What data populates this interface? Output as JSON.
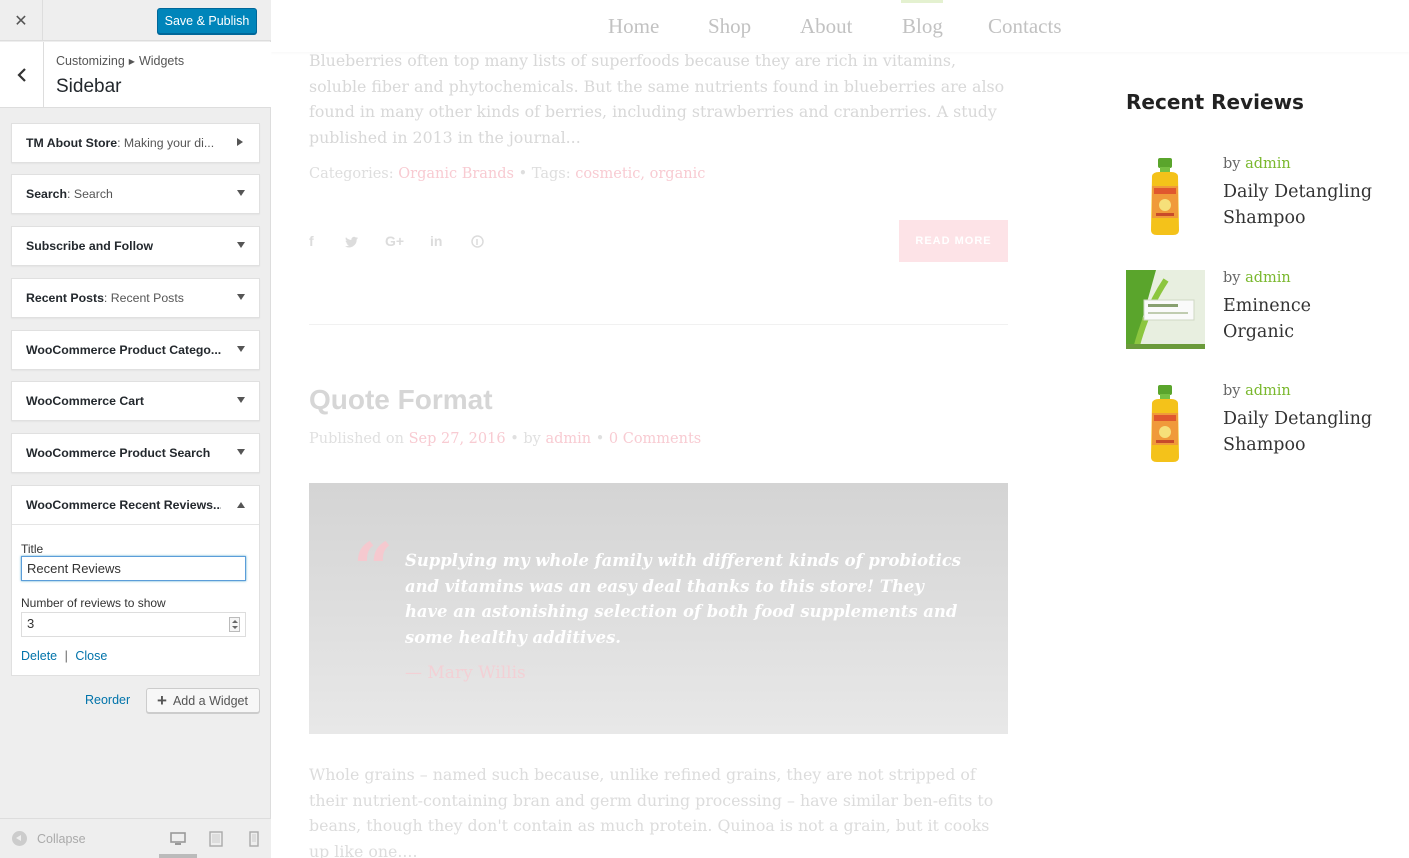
{
  "customizer": {
    "close_icon": "close-icon",
    "publish_label": "Save & Publish",
    "breadcrumb": {
      "root": "Customizing",
      "current": "Widgets"
    },
    "section_title": "Sidebar",
    "widgets": [
      {
        "name": "TM About Store",
        "sub": ": Making your di...",
        "state": "collapsed-right"
      },
      {
        "name": "Search",
        "sub": ": Search",
        "state": "collapsed"
      },
      {
        "name": "Subscribe and Follow",
        "sub": "",
        "state": "collapsed"
      },
      {
        "name": "Recent Posts",
        "sub": ": Recent Posts",
        "state": "collapsed"
      },
      {
        "name": "WooCommerce Product Catego...",
        "sub": "",
        "state": "collapsed"
      },
      {
        "name": "WooCommerce Cart",
        "sub": "",
        "state": "collapsed"
      },
      {
        "name": "WooCommerce Product Search",
        "sub": "",
        "state": "collapsed"
      }
    ],
    "open_widget": {
      "name": "WooCommerce Recent Reviews...",
      "title_label": "Title",
      "title_value": "Recent Reviews",
      "count_label": "Number of reviews to show",
      "count_value": "3",
      "delete_label": "Delete",
      "separator": "|",
      "close_label": "Close"
    },
    "reorder_label": "Reorder",
    "add_widget_label": "Add a Widget",
    "collapse_label": "Collapse"
  },
  "preview": {
    "nav": [
      "Home",
      "Shop",
      "About",
      "Blog",
      "Contacts"
    ],
    "active_nav": "Blog",
    "post1": {
      "excerpt": "Blueberries often top many lists of superfoods because they are rich in vitamins, soluble fiber and phytochemicals. But the same nutrients found in blueberries are also found in many other kinds of berries, including strawberries and cranberries. A study published in 2013 in the journal...",
      "categories_label": "Categories:",
      "category": "Organic Brands",
      "tags_label": "Tags:",
      "tag1": "cosmetic",
      "tag2": "organic",
      "read_more": "READ MORE"
    },
    "post2": {
      "title": "Quote Format",
      "published_label": "Published on",
      "date": "Sep 27, 2016",
      "by_label": "by",
      "author": "admin",
      "comments": "0 Comments",
      "quote": "Supplying my whole family with different kinds of probiotics and vitamins was an easy deal thanks to this store! They have an astonishing selection of both food supplements and some healthy additives.",
      "quote_author": "— Mary Willis"
    },
    "excerpt2": "Whole grains – named such because, unlike refined grains, they are not stripped of their nutrient-containing bran and germ during processing – have similar ben-efits to beans, though they don't contain as much protein. Quinoa is not a grain, but it cooks up like one....",
    "sidebar": {
      "title": "Recent Reviews",
      "reviews": [
        {
          "by": "by",
          "author": "admin",
          "product": "Daily Detangling Shampoo"
        },
        {
          "by": "by",
          "author": "admin",
          "product": "Eminence Organic"
        },
        {
          "by": "by",
          "author": "admin",
          "product": "Daily Detangling Shampoo"
        }
      ]
    }
  },
  "colors": {
    "primary_button": "#0085ba",
    "accent_green": "#7ab82e",
    "accent_pink": "#f8cbd2"
  }
}
